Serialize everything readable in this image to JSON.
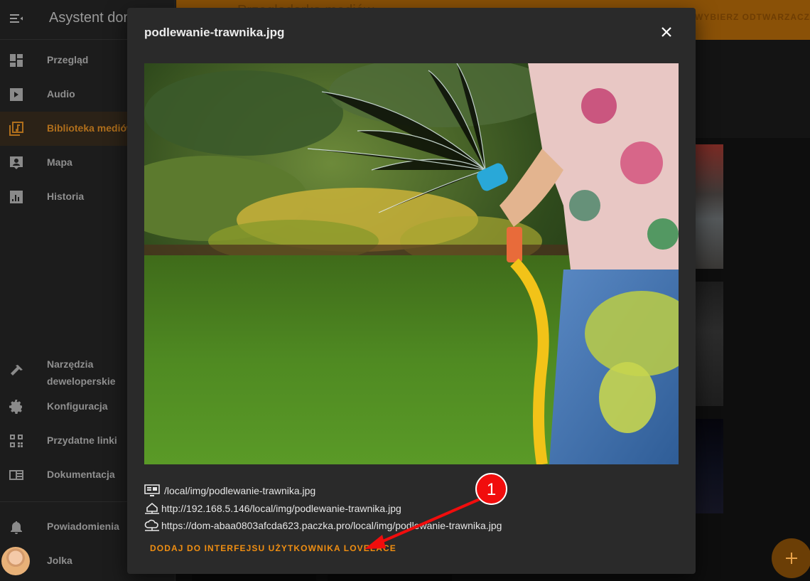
{
  "app": {
    "title": "Asystent domowy"
  },
  "sidebar": {
    "items": [
      {
        "label": "Przegląd",
        "icon": "dashboard-icon"
      },
      {
        "label": "Audio",
        "icon": "play-box-icon"
      },
      {
        "label": "Biblioteka mediów",
        "icon": "media-library-icon",
        "active": true
      },
      {
        "label": "Mapa",
        "icon": "account-box-icon"
      },
      {
        "label": "Historia",
        "icon": "chart-box-icon"
      }
    ],
    "tools": [
      {
        "label": "Narzędzia deweloperskie",
        "icon": "hammer-icon"
      },
      {
        "label": "Konfiguracja",
        "icon": "gear-icon"
      },
      {
        "label": "Przydatne linki",
        "icon": "qrcode-icon"
      },
      {
        "label": "Dokumentacja",
        "icon": "book-icon"
      }
    ],
    "notifications": {
      "label": "Powiadomienia",
      "icon": "bell-icon"
    },
    "user": {
      "label": "Jolka"
    }
  },
  "header": {
    "title": "Przeglądarka mediów",
    "pick_player": "WYBIERZ ODTWARZACZ"
  },
  "dialog": {
    "title": "podlewanie-trawnika.jpg",
    "urls": [
      {
        "icon": "monitor-icon",
        "text": "/local/img/podlewanie-trawnika.jpg"
      },
      {
        "icon": "home-lan-icon",
        "text": "http://192.168.5.146/local/img/podlewanie-trawnika.jpg"
      },
      {
        "icon": "cloud-icon",
        "text": "https://dom-abaa0803afcda623.paczka.pro/local/img/podlewanie-trawnika.jpg"
      }
    ],
    "add_button": "DODAJ DO INTERFEJSU UŻYTKOWNIKA LOVELACE"
  },
  "annotation": {
    "number": "1"
  },
  "colors": {
    "accent": "#ef8e12",
    "header": "#8a5107",
    "dialog_bg": "#2a2a2a",
    "marker": "#f10d0d"
  }
}
